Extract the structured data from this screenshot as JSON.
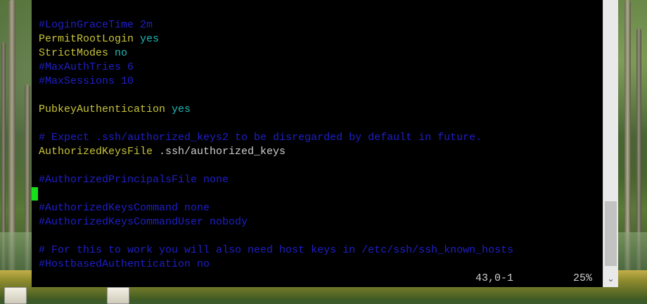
{
  "editor": {
    "lines": [
      {
        "top": 0,
        "parts": [
          {
            "text": "#LoginGraceTime 2m",
            "cls": "c-comment"
          }
        ]
      },
      {
        "top": 0,
        "parts": [
          {
            "text": "PermitRootLogin",
            "cls": "c-key"
          },
          {
            "text": " ",
            "cls": "c-plain"
          },
          {
            "text": "yes",
            "cls": "c-val"
          }
        ]
      },
      {
        "top": 0,
        "parts": [
          {
            "text": "StrictModes",
            "cls": "c-key"
          },
          {
            "text": " ",
            "cls": "c-plain"
          },
          {
            "text": "no",
            "cls": "c-val"
          }
        ]
      },
      {
        "top": 0,
        "parts": [
          {
            "text": "#MaxAuthTries 6",
            "cls": "c-comment"
          }
        ]
      },
      {
        "top": 0,
        "parts": [
          {
            "text": "#MaxSessions 10",
            "cls": "c-comment"
          }
        ]
      },
      {
        "top": 0,
        "parts": [
          {
            "text": "PubkeyAuthentication",
            "cls": "c-key"
          },
          {
            "text": " ",
            "cls": "c-plain"
          },
          {
            "text": "yes",
            "cls": "c-val"
          }
        ]
      },
      {
        "top": 0,
        "parts": [
          {
            "text": "# Expect .ssh/authorized_keys2 to be disregarded by default in future.",
            "cls": "c-comment"
          }
        ]
      },
      {
        "top": 0,
        "parts": [
          {
            "text": "AuthorizedKeysFile",
            "cls": "c-key"
          },
          {
            "text": " .ssh/authorized_keys",
            "cls": "c-plain"
          }
        ]
      },
      {
        "top": 0,
        "parts": [
          {
            "text": "#AuthorizedPrincipalsFile none",
            "cls": "c-comment"
          }
        ]
      },
      {
        "top": 0,
        "parts": [
          {
            "text": "#AuthorizedKeysCommand none",
            "cls": "c-comment"
          }
        ]
      },
      {
        "top": 0,
        "parts": [
          {
            "text": "#AuthorizedKeysCommandUser nobody",
            "cls": "c-comment"
          }
        ]
      },
      {
        "top": 0,
        "parts": [
          {
            "text": "# For this to work you will also need host keys in /etc/ssh/ssh_known_hosts",
            "cls": "c-comment"
          }
        ]
      },
      {
        "top": 0,
        "parts": [
          {
            "text": "#HostbasedAuthentication no",
            "cls": "c-comment"
          }
        ]
      }
    ],
    "status_position": "43,0-1",
    "status_percent": "25%"
  }
}
